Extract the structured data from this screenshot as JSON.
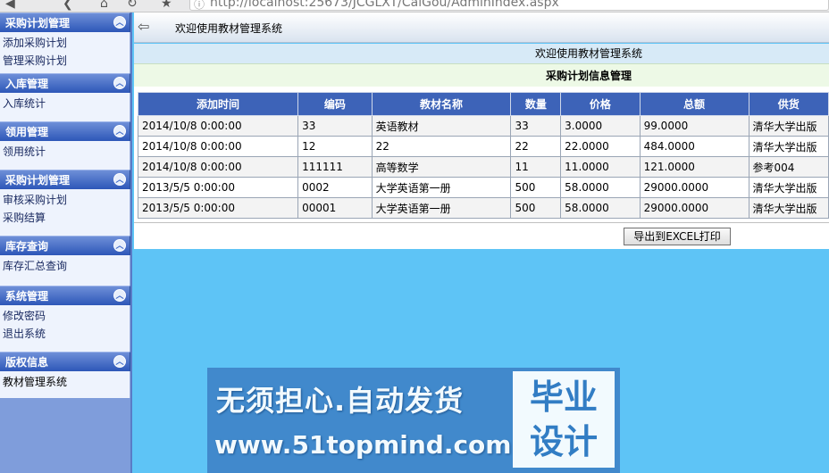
{
  "browser": {
    "url": "http://localhost:25673/JCGLXT/CaiGou/AdminIndex.aspx"
  },
  "sidebar": {
    "groups": [
      {
        "title": "采购计划管理",
        "items": [
          "添加采购计划",
          "管理采购计划"
        ]
      },
      {
        "title": "入库管理",
        "items": [
          "入库统计"
        ]
      },
      {
        "title": "领用管理",
        "items": [
          "领用统计"
        ]
      },
      {
        "title": "采购计划管理",
        "items": [
          "审核采购计划",
          "采购结算"
        ]
      },
      {
        "title": "库存查询",
        "items": [
          "库存汇总查询"
        ]
      },
      {
        "title": "系统管理",
        "items": [
          "修改密码",
          "退出系统"
        ]
      },
      {
        "title": "版权信息",
        "items": [
          "教材管理系统"
        ]
      }
    ],
    "toggle_glyph": "⌃"
  },
  "header": {
    "title": "欢迎使用教材管理系统"
  },
  "main": {
    "welcome": "欢迎使用教材管理系统",
    "section_title": "采购计划信息管理",
    "table": {
      "columns": [
        "添加时间",
        "编码",
        "教材名称",
        "数量",
        "价格",
        "总额",
        "供货"
      ],
      "rows": [
        [
          "2014/10/8 0:00:00",
          "33",
          "英语教材",
          "33",
          "3.0000",
          "99.0000",
          "清华大学出版"
        ],
        [
          "2014/10/8 0:00:00",
          "12",
          "22",
          "22",
          "22.0000",
          "484.0000",
          "清华大学出版"
        ],
        [
          "2014/10/8 0:00:00",
          "111111",
          "高等数学",
          "11",
          "11.0000",
          "121.0000",
          "参考004"
        ],
        [
          "2013/5/5 0:00:00",
          "0002",
          "大学英语第一册",
          "500",
          "58.0000",
          "29000.0000",
          "清华大学出版"
        ],
        [
          "2013/5/5 0:00:00",
          "00001",
          "大学英语第一册",
          "500",
          "58.0000",
          "29000.0000",
          "清华大学出版"
        ]
      ]
    },
    "export_label": "导出到EXCEL打印"
  },
  "watermark": {
    "line1": "无须担心.自动发货",
    "line2": "www.51topmind.com",
    "badge_line1": "毕业",
    "badge_line2": "设计"
  },
  "colors": {
    "sidebar_header": "#2d57b8",
    "table_header": "#3d63b8",
    "background": "#5ec4f6"
  }
}
